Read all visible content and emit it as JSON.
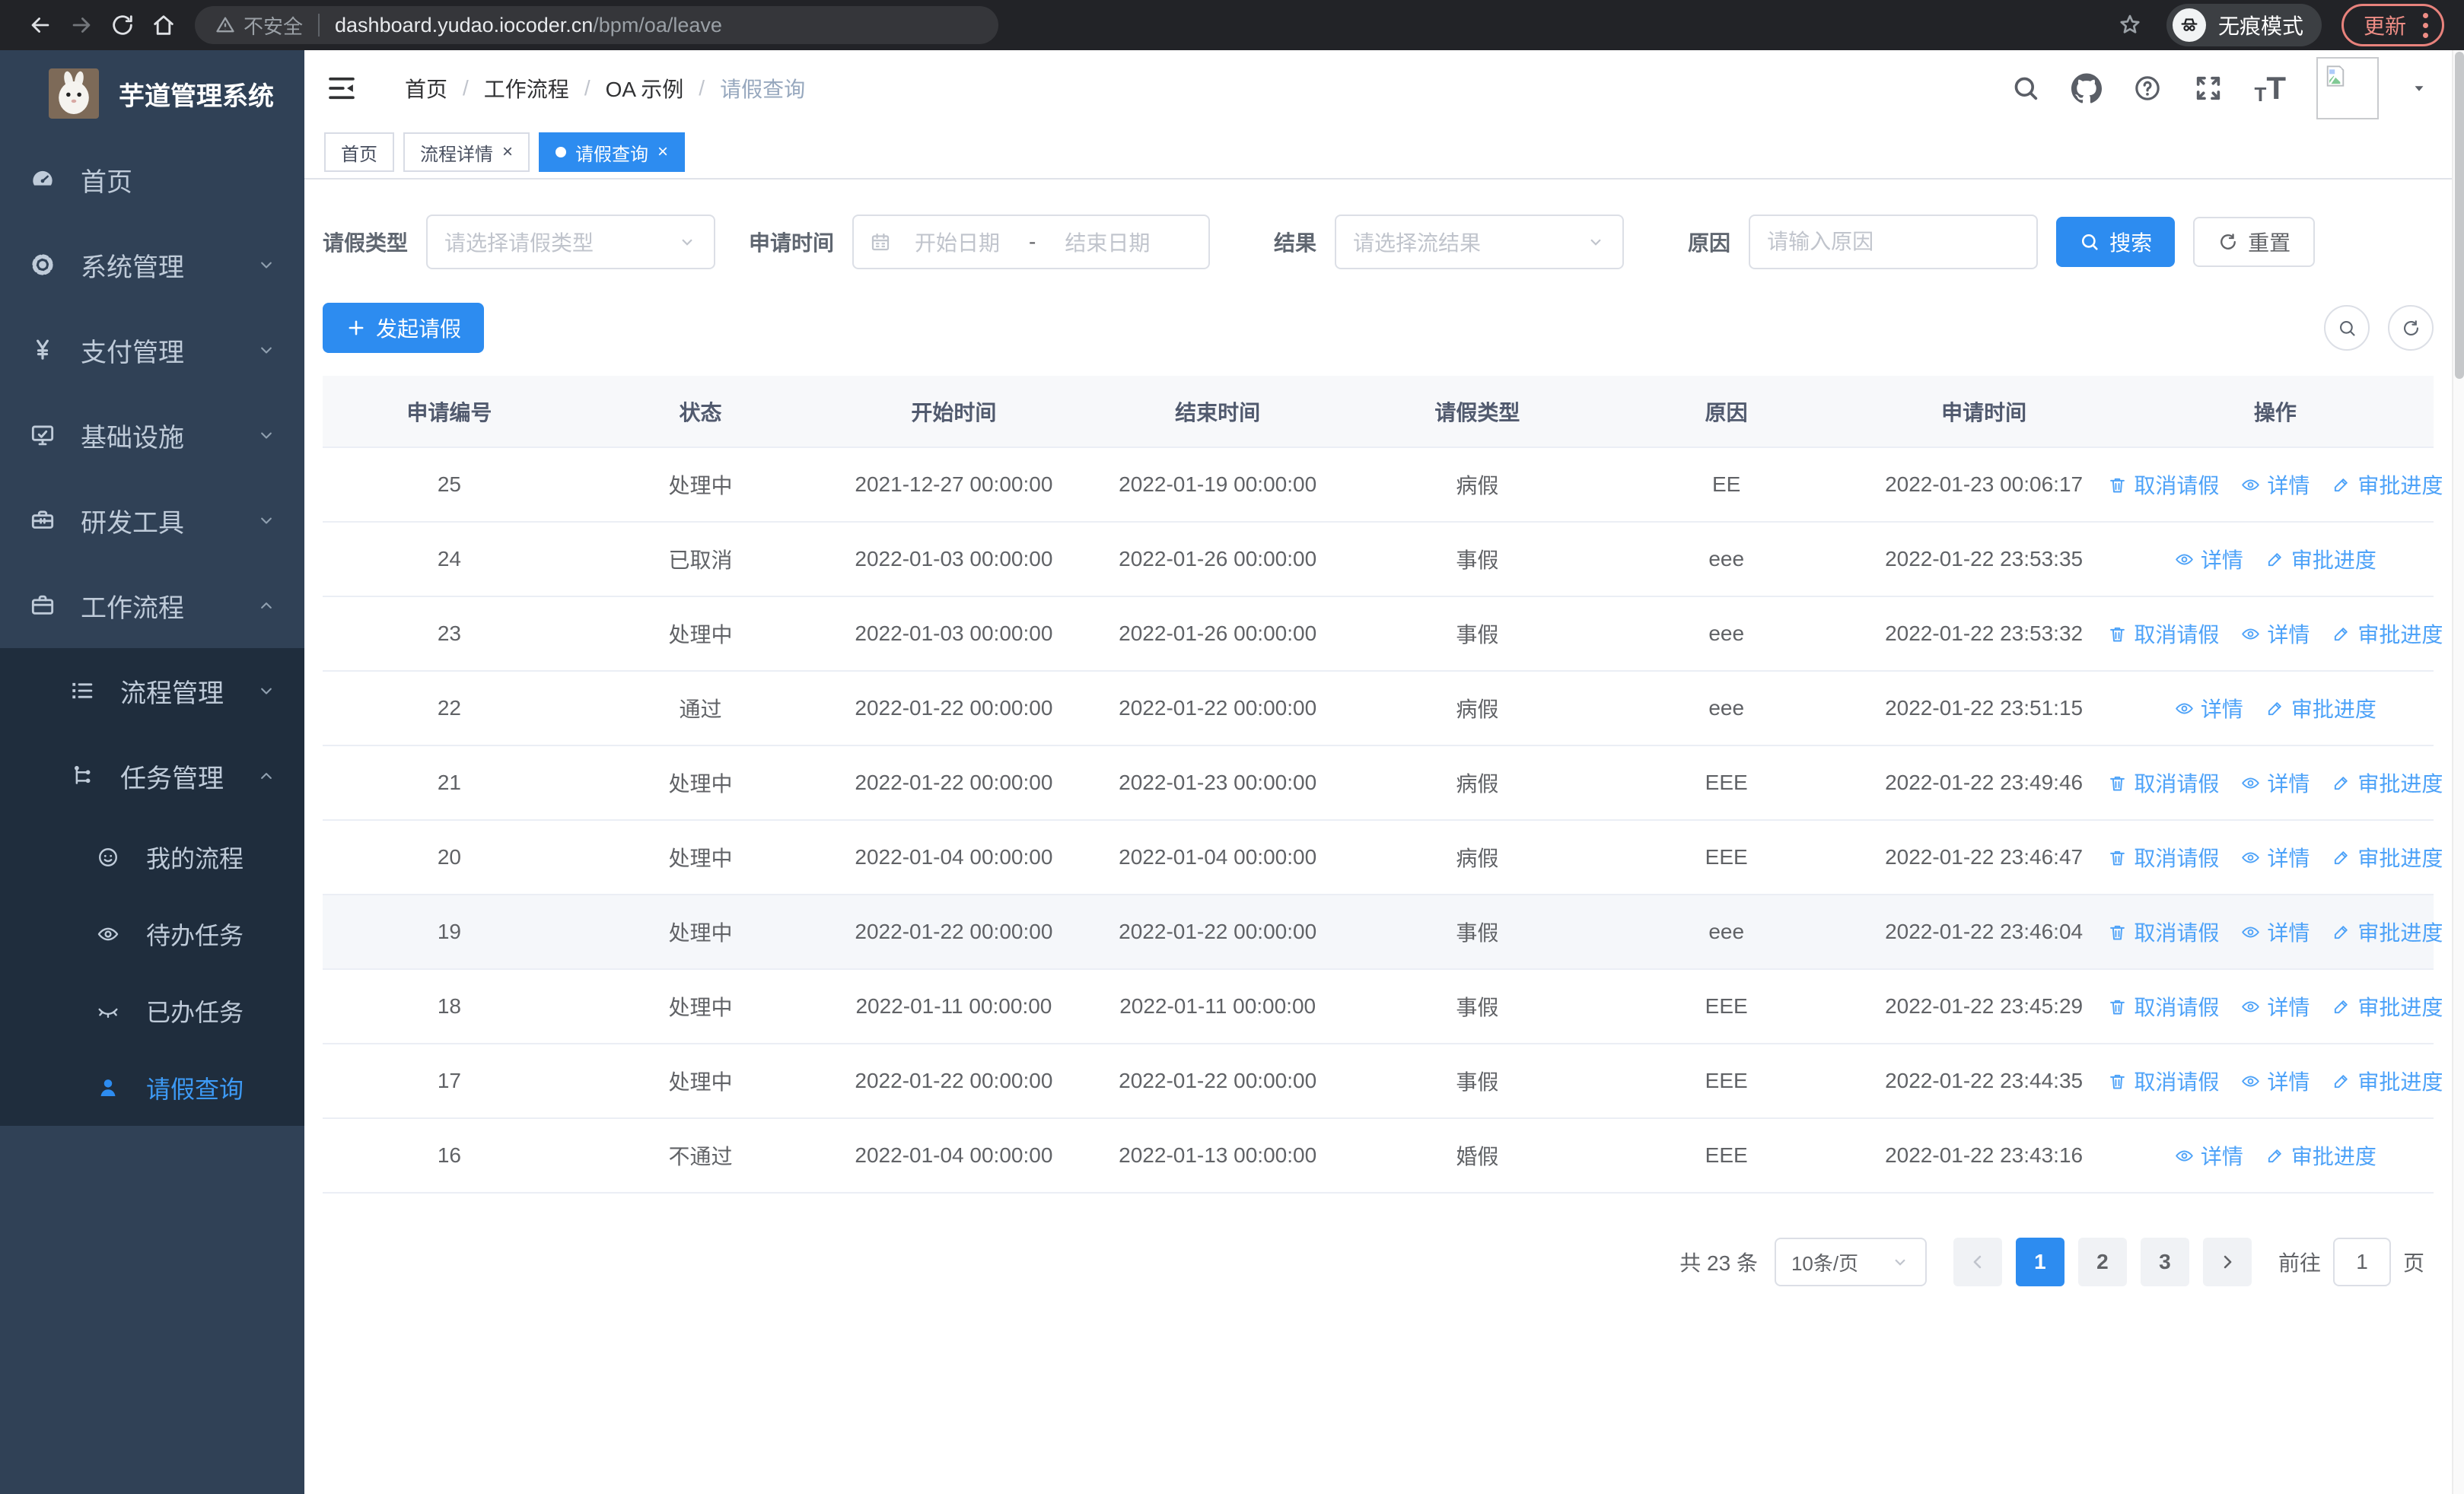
{
  "colors": {
    "primary": "#2d8cf0",
    "link": "#4da2f8",
    "sidebar_bg": "#304156",
    "submenu_bg": "#1f2d3d",
    "sidebar_text": "#bfcbd9",
    "update_accent": "#ee8d85",
    "table_header_bg": "#f7f8fa"
  },
  "browser": {
    "security_label": "不安全",
    "url_domain": "dashboard.yudao.iocoder.cn",
    "url_path": "/bpm/oa/leave",
    "incognito_label": "无痕模式",
    "update_label": "更新"
  },
  "sidebar": {
    "title": "芋道管理系统",
    "items": [
      {
        "label": "首页",
        "icon": "dashboard-icon",
        "level": 1,
        "expandable": false,
        "sub": false,
        "active": false
      },
      {
        "label": "系统管理",
        "icon": "gear-icon",
        "level": 1,
        "expandable": true,
        "expanded": false,
        "sub": false,
        "active": false
      },
      {
        "label": "支付管理",
        "icon": "yen-icon",
        "level": 1,
        "expandable": true,
        "expanded": false,
        "sub": false,
        "active": false
      },
      {
        "label": "基础设施",
        "icon": "monitor-icon",
        "level": 1,
        "expandable": true,
        "expanded": false,
        "sub": false,
        "active": false
      },
      {
        "label": "研发工具",
        "icon": "toolbox-icon",
        "level": 1,
        "expandable": true,
        "expanded": false,
        "sub": false,
        "active": false
      },
      {
        "label": "工作流程",
        "icon": "briefcase-icon",
        "level": 1,
        "expandable": true,
        "expanded": true,
        "sub": false,
        "active": false
      },
      {
        "label": "流程管理",
        "icon": "list-icon",
        "level": 2,
        "expandable": true,
        "expanded": false,
        "sub": true,
        "active": false
      },
      {
        "label": "任务管理",
        "icon": "tree-icon",
        "level": 2,
        "expandable": true,
        "expanded": true,
        "sub": true,
        "active": false
      },
      {
        "label": "我的流程",
        "icon": "face-icon",
        "level": 3,
        "expandable": false,
        "sub": true,
        "active": false
      },
      {
        "label": "待办任务",
        "icon": "eye-icon",
        "level": 3,
        "expandable": false,
        "sub": true,
        "active": false
      },
      {
        "label": "已办任务",
        "icon": "eye-closed-icon",
        "level": 3,
        "expandable": false,
        "sub": true,
        "active": false
      },
      {
        "label": "请假查询",
        "icon": "user-icon",
        "level": 3,
        "expandable": false,
        "sub": true,
        "active": true
      }
    ]
  },
  "breadcrumb": [
    "首页",
    "工作流程",
    "OA 示例",
    "请假查询"
  ],
  "tabs": [
    {
      "label": "首页",
      "closable": false,
      "active": false
    },
    {
      "label": "流程详情",
      "closable": true,
      "active": false
    },
    {
      "label": "请假查询",
      "closable": true,
      "active": true
    }
  ],
  "filters": {
    "leave_type_label": "请假类型",
    "leave_type_placeholder": "请选择请假类型",
    "apply_time_label": "申请时间",
    "start_date_placeholder": "开始日期",
    "range_separator": "-",
    "end_date_placeholder": "结束日期",
    "result_label": "结果",
    "result_placeholder": "请选择流结果",
    "reason_label": "原因",
    "reason_placeholder": "请输入原因",
    "search_label": "搜索",
    "reset_label": "重置"
  },
  "toolbar": {
    "create_label": "发起请假"
  },
  "table": {
    "columns": [
      "申请编号",
      "状态",
      "开始时间",
      "结束时间",
      "请假类型",
      "原因",
      "申请时间",
      "操作"
    ],
    "action_labels": {
      "cancel": "取消请假",
      "detail": "详情",
      "progress": "审批进度"
    },
    "rows": [
      {
        "id": "25",
        "status": "处理中",
        "start": "2021-12-27 00:00:00",
        "end": "2022-01-19 00:00:00",
        "type": "病假",
        "reason": "EE",
        "applied": "2022-01-23 00:06:17",
        "actions": [
          "cancel",
          "detail",
          "progress"
        ],
        "highlight": false
      },
      {
        "id": "24",
        "status": "已取消",
        "start": "2022-01-03 00:00:00",
        "end": "2022-01-26 00:00:00",
        "type": "事假",
        "reason": "eee",
        "applied": "2022-01-22 23:53:35",
        "actions": [
          "detail",
          "progress"
        ],
        "highlight": false
      },
      {
        "id": "23",
        "status": "处理中",
        "start": "2022-01-03 00:00:00",
        "end": "2022-01-26 00:00:00",
        "type": "事假",
        "reason": "eee",
        "applied": "2022-01-22 23:53:32",
        "actions": [
          "cancel",
          "detail",
          "progress"
        ],
        "highlight": false
      },
      {
        "id": "22",
        "status": "通过",
        "start": "2022-01-22 00:00:00",
        "end": "2022-01-22 00:00:00",
        "type": "病假",
        "reason": "eee",
        "applied": "2022-01-22 23:51:15",
        "actions": [
          "detail",
          "progress"
        ],
        "highlight": false
      },
      {
        "id": "21",
        "status": "处理中",
        "start": "2022-01-22 00:00:00",
        "end": "2022-01-23 00:00:00",
        "type": "病假",
        "reason": "EEE",
        "applied": "2022-01-22 23:49:46",
        "actions": [
          "cancel",
          "detail",
          "progress"
        ],
        "highlight": false
      },
      {
        "id": "20",
        "status": "处理中",
        "start": "2022-01-04 00:00:00",
        "end": "2022-01-04 00:00:00",
        "type": "病假",
        "reason": "EEE",
        "applied": "2022-01-22 23:46:47",
        "actions": [
          "cancel",
          "detail",
          "progress"
        ],
        "highlight": false
      },
      {
        "id": "19",
        "status": "处理中",
        "start": "2022-01-22 00:00:00",
        "end": "2022-01-22 00:00:00",
        "type": "事假",
        "reason": "eee",
        "applied": "2022-01-22 23:46:04",
        "actions": [
          "cancel",
          "detail",
          "progress"
        ],
        "highlight": true
      },
      {
        "id": "18",
        "status": "处理中",
        "start": "2022-01-11 00:00:00",
        "end": "2022-01-11 00:00:00",
        "type": "事假",
        "reason": "EEE",
        "applied": "2022-01-22 23:45:29",
        "actions": [
          "cancel",
          "detail",
          "progress"
        ],
        "highlight": false
      },
      {
        "id": "17",
        "status": "处理中",
        "start": "2022-01-22 00:00:00",
        "end": "2022-01-22 00:00:00",
        "type": "事假",
        "reason": "EEE",
        "applied": "2022-01-22 23:44:35",
        "actions": [
          "cancel",
          "detail",
          "progress"
        ],
        "highlight": false
      },
      {
        "id": "16",
        "status": "不通过",
        "start": "2022-01-04 00:00:00",
        "end": "2022-01-13 00:00:00",
        "type": "婚假",
        "reason": "EEE",
        "applied": "2022-01-22 23:43:16",
        "actions": [
          "detail",
          "progress"
        ],
        "highlight": false
      }
    ]
  },
  "pagination": {
    "total_label": "共 23 条",
    "page_size": "10条/页",
    "pages": [
      "1",
      "2",
      "3"
    ],
    "active_page": "1",
    "goto_label": "前往",
    "goto_value": "1",
    "page_unit": "页"
  }
}
